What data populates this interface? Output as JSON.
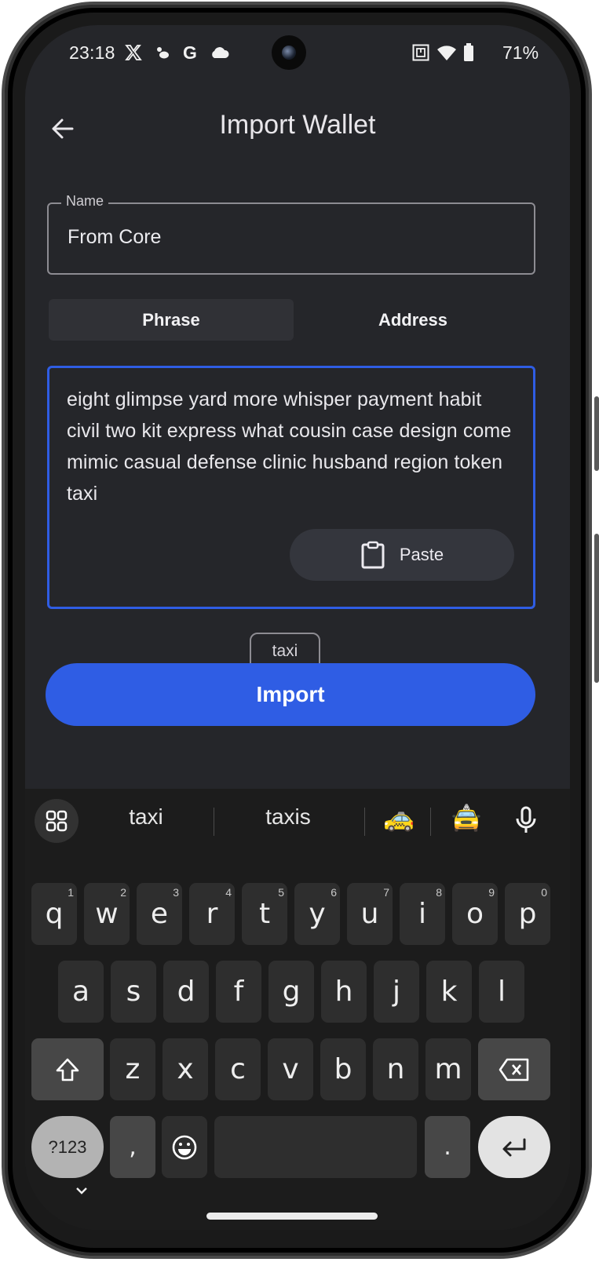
{
  "status_bar": {
    "time": "23:18",
    "left_icons": [
      "x-app-icon",
      "cloud-weather-icon",
      "google-icon",
      "cloud-icon"
    ],
    "right_icons": [
      "nfc-icon",
      "wifi-icon",
      "battery-icon"
    ],
    "battery_percent": "71%"
  },
  "header": {
    "title": "Import Wallet",
    "back_icon": "arrow-left-icon"
  },
  "name_field": {
    "label": "Name",
    "value": "From Core"
  },
  "tabs": [
    {
      "label": "Phrase",
      "active": true
    },
    {
      "label": "Address",
      "active": false
    }
  ],
  "phrase_field": {
    "value": "eight glimpse yard more whisper payment habit civil two kit express what cousin case design come mimic casual defense clinic husband region token taxi",
    "focused": true
  },
  "paste_button": {
    "label": "Paste",
    "icon": "clipboard-icon"
  },
  "tooltip": {
    "text": "taxi"
  },
  "import_button": {
    "label": "Import"
  },
  "colors": {
    "accent": "#2f5de4",
    "background": "#25262a",
    "keyboard_bg": "#1c1c1c"
  },
  "keyboard": {
    "suggestions": [
      "taxi",
      "taxis"
    ],
    "emoji_suggestions": [
      "🚕",
      "🚖"
    ],
    "row1": [
      {
        "k": "q",
        "n": "1"
      },
      {
        "k": "w",
        "n": "2"
      },
      {
        "k": "e",
        "n": "3"
      },
      {
        "k": "r",
        "n": "4"
      },
      {
        "k": "t",
        "n": "5"
      },
      {
        "k": "y",
        "n": "6"
      },
      {
        "k": "u",
        "n": "7"
      },
      {
        "k": "i",
        "n": "8"
      },
      {
        "k": "o",
        "n": "9"
      },
      {
        "k": "p",
        "n": "0"
      }
    ],
    "row2": [
      "a",
      "s",
      "d",
      "f",
      "g",
      "h",
      "j",
      "k",
      "l"
    ],
    "row3": [
      "z",
      "x",
      "c",
      "v",
      "b",
      "n",
      "m"
    ],
    "symbols_label": "?123",
    "comma": ",",
    "period": "."
  }
}
